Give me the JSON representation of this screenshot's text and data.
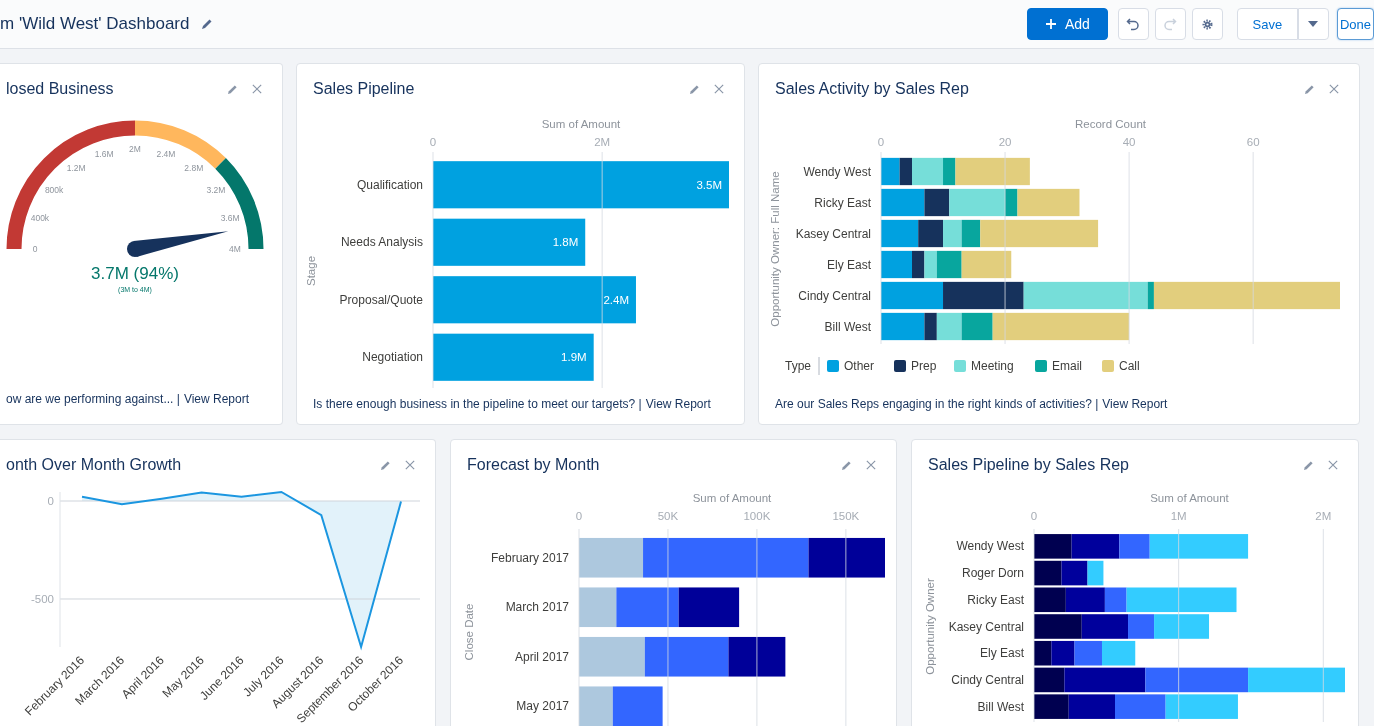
{
  "header": {
    "title": "m 'Wild West' Dashboard",
    "buttons": [
      {
        "kind": "add",
        "label": "Add"
      },
      {
        "kind": "undo",
        "disabled": false
      },
      {
        "kind": "redo",
        "disabled": true
      },
      {
        "kind": "settings"
      },
      {
        "kind": "save",
        "label": "Save"
      },
      {
        "kind": "menu"
      },
      {
        "kind": "done",
        "label": "Done"
      }
    ]
  },
  "rows": [
    {
      "cards": [
        {
          "kind": "gauge",
          "title": "losed Business",
          "gauge": {
            "value": "3.7M (94%)",
            "range": "(3M to 4M)",
            "ticks": [
              "0",
              "400k",
              "800k",
              "1.2M",
              "1.6M",
              "2M",
              "2.4M",
              "2.8M",
              "3.2M",
              "3.6M",
              "4M"
            ],
            "bands": [
              {
                "color": "#c23934"
              },
              {
                "color": "#ffb75d"
              },
              {
                "color": "#04776b"
              }
            ]
          },
          "footer": {
            "question": "ow are we performing against... |",
            "link": "View Report"
          }
        },
        {
          "kind": "hbar",
          "title": "Sales Pipeline",
          "chart_data": {
            "type": "bar",
            "orientation": "horizontal",
            "xlabel": "Sum of Amount",
            "ylabel": "Stage",
            "categories": [
              "Qualification",
              "Needs Analysis",
              "Proposal/Quote",
              "Negotiation"
            ],
            "series": [
              {
                "color": "#00a1e0",
                "values": [
                  3500000,
                  1800000,
                  2400000,
                  1900000
                ]
              }
            ],
            "grid": true,
            "xlim": [
              0,
              3500000
            ],
            "xticks": [
              0,
              {
                "value": 2000000,
                "label": "2M"
              }
            ],
            "value_labels": [
              "3.5M",
              "1.8M",
              "2.4M",
              "1.9M"
            ]
          },
          "footer": {
            "question": "Is there enough business in the pipeline to meet our targets? |",
            "link": "View Report"
          }
        },
        {
          "kind": "hbar",
          "title": "Sales Activity by Sales Rep",
          "legend_title": "Type",
          "chart_data": {
            "type": "bar",
            "orientation": "horizontal",
            "stacked": true,
            "xlabel": "Record Count",
            "ylabel": "Opportunity Owner: Full Name",
            "categories": [
              "Wendy West",
              "Ricky East",
              "Kasey Central",
              "Ely East",
              "Cindy Central",
              "Bill West"
            ],
            "series": [
              {
                "name": "Other",
                "color": "#00a1e0",
                "values": [
                  3,
                  7,
                  6,
                  5,
                  10,
                  7
                ]
              },
              {
                "name": "Prep",
                "color": "#16325c",
                "values": [
                  2,
                  4,
                  4,
                  2,
                  13,
                  2
                ]
              },
              {
                "name": "Meeting",
                "color": "#76ded9",
                "values": [
                  5,
                  9,
                  3,
                  2,
                  20,
                  4
                ]
              },
              {
                "name": "Email",
                "color": "#08a69e",
                "values": [
                  2,
                  2,
                  3,
                  4,
                  1,
                  5
                ]
              },
              {
                "name": "Call",
                "color": "#e2ce7d",
                "values": [
                  12,
                  10,
                  19,
                  8,
                  30,
                  22
                ]
              }
            ],
            "grid": true,
            "legend": "bottom",
            "xlim": [
              0,
              74
            ],
            "xticks": [
              0,
              20,
              40,
              60
            ]
          },
          "footer": {
            "question": "Are our Sales Reps engaging in the right kinds of activities? |",
            "link": "View Report"
          }
        }
      ]
    },
    {
      "cards": [
        {
          "kind": "line",
          "title": "onth Over Month Growth",
          "chart_data": {
            "type": "area",
            "x": [
              "February 2016",
              "March 2016",
              "April 2016",
              "May 2016",
              "June 2016",
              "July 2016",
              "August 2016",
              "September 2016",
              "October 2016"
            ],
            "series": [
              {
                "color": "#1b96e0",
                "values": [
                  22,
                  -17,
                  12,
                  43,
                  22,
                  46,
                  -72,
                  -745,
                  -3
                ]
              }
            ],
            "grid": true,
            "ylim": [
              -745,
              46
            ],
            "yticks": [
              0,
              -500
            ]
          }
        },
        {
          "kind": "hbar",
          "title": "Forecast by Month",
          "chart_data": {
            "type": "bar",
            "orientation": "horizontal",
            "stacked": true,
            "xlabel": "Sum of Amount",
            "ylabel": "Close Date",
            "categories": [
              "February 2017",
              "March 2017",
              "April 2017",
              "May 2017"
            ],
            "series": [
              {
                "color": "#adc8de",
                "values": [
                  36000,
                  21000,
                  37000,
                  19000
                ]
              },
              {
                "color": "#3366ff",
                "values": [
                  93000,
                  35000,
                  47000,
                  28000
                ]
              },
              {
                "color": "#000099",
                "values": [
                  43000,
                  34000,
                  32000,
                  null
                ]
              }
            ],
            "grid": true,
            "xlim": [
              0,
              172000
            ],
            "xticks": [
              0,
              {
                "value": 50000,
                "label": "50K"
              },
              {
                "value": 100000,
                "label": "100K"
              },
              {
                "value": 150000,
                "label": "150K"
              }
            ]
          }
        },
        {
          "kind": "hbar",
          "title": "Sales Pipeline by Sales Rep",
          "chart_data": {
            "type": "bar",
            "orientation": "horizontal",
            "stacked": true,
            "xlabel": "Sum of Amount",
            "ylabel": "Opportunity Owner",
            "categories": [
              "Wendy West",
              "Roger Dorn",
              "Ricky East",
              "Kasey Central",
              "Ely East",
              "Cindy Central",
              "Bill West"
            ],
            "series": [
              {
                "color": "#000050",
                "values": [
                  260000,
                  190000,
                  220000,
                  330000,
                  120000,
                  210000,
                  240000
                ]
              },
              {
                "color": "#00009c",
                "values": [
                  330000,
                  180000,
                  270000,
                  320000,
                  160000,
                  560000,
                  320000
                ]
              },
              {
                "color": "#3366ff",
                "values": [
                  210000,
                  null,
                  150000,
                  180000,
                  190000,
                  710000,
                  350000
                ]
              },
              {
                "color": "#33ccff",
                "values": [
                  680000,
                  110000,
                  760000,
                  380000,
                  230000,
                  670000,
                  500000
                ]
              }
            ],
            "grid": true,
            "xlim": [
              0,
              2150000
            ],
            "xticks": [
              0,
              {
                "value": 1000000,
                "label": "1M"
              },
              {
                "value": 2000000,
                "label": "2M"
              }
            ]
          }
        }
      ]
    }
  ]
}
